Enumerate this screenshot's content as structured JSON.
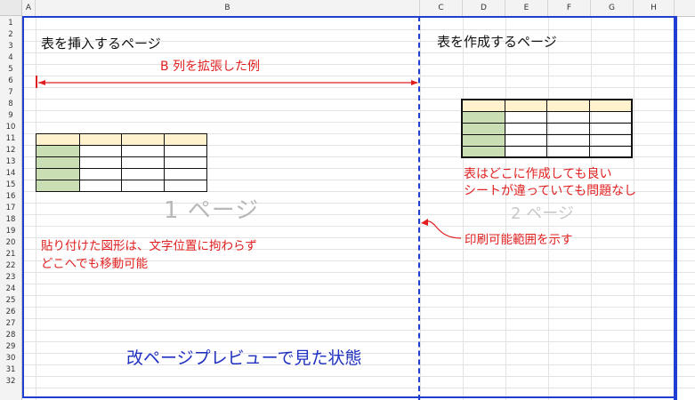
{
  "columns": [
    "A",
    "B",
    "C",
    "D",
    "E",
    "F",
    "G",
    "H"
  ],
  "rows": [
    "1",
    "2",
    "3",
    "4",
    "5",
    "6",
    "7",
    "8",
    "9",
    "10",
    "11",
    "12",
    "13",
    "14",
    "15",
    "16",
    "17",
    "18",
    "19",
    "20",
    "21",
    "22",
    "23",
    "24",
    "25",
    "26",
    "27",
    "28",
    "29",
    "30",
    "31",
    "32"
  ],
  "page1": {
    "heading": "表を挿入するページ",
    "extend_label": "B 列を拡張した例",
    "page_label": "1 ページ",
    "shape_note_line1": "貼り付けた図形は、文字位置に拘わらず",
    "shape_note_line2": "どこへでも移動可能",
    "table": {
      "rows": 5,
      "cols": 4
    }
  },
  "page2": {
    "heading": "表を作成するページ",
    "note_line1": "表はどこに作成しても良い",
    "note_line2": "シートが違っていても問題なし",
    "page_label": "2 ページ",
    "print_range_note": "印刷可能範囲を示す",
    "table": {
      "rows": 5,
      "cols": 4
    }
  },
  "footer_caption": "改ページプレビューで見た状態",
  "colors": {
    "page_frame": "#1f3fd0",
    "annotation_red": "#e02020",
    "caption_blue": "#2030c0",
    "table_header_fill": "#fff2cc",
    "table_side_fill": "#c9dfb3"
  }
}
